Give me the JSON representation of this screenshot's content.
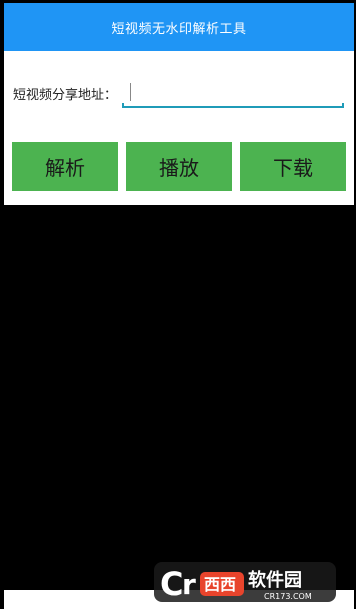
{
  "app_bar": {
    "title": "短视频无水印解析工具",
    "color": "#1f95f5"
  },
  "form": {
    "url_label": "短视频分享地址：",
    "url_value": "",
    "url_placeholder": ""
  },
  "buttons": {
    "parse_label": "解析",
    "play_label": "播放",
    "download_label": "下载",
    "color": "#4cb350"
  },
  "watermark": {
    "text": "西西软件园",
    "domain": "CR173.COM"
  }
}
